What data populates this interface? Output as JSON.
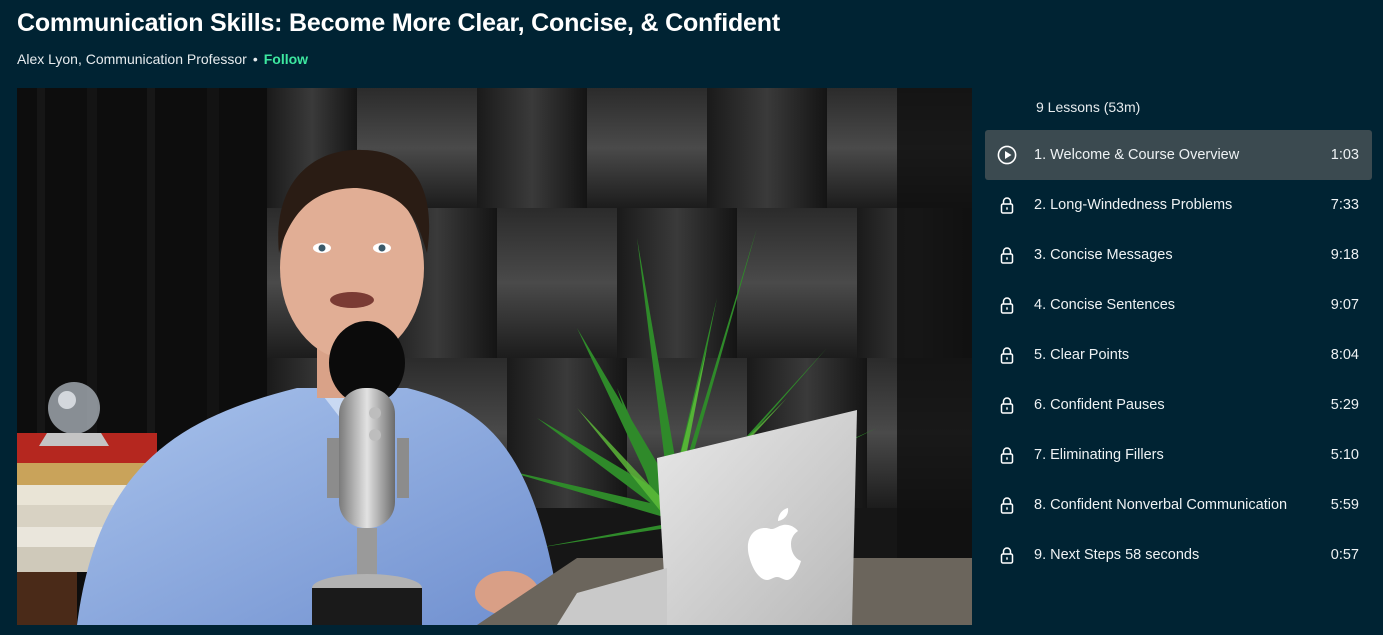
{
  "course": {
    "title": "Communication Skills: Become More Clear, Concise, & Confident",
    "author": "Alex Lyon, Communication Professor",
    "separator": "•",
    "follow_label": "Follow"
  },
  "video": {
    "scene_icon": "apple-logo-icon"
  },
  "lessons_summary": "9 Lessons (53m)",
  "lessons": [
    {
      "label": "1. Welcome & Course Overview",
      "duration": "1:03",
      "state": "playing",
      "icon": "play-circle-icon"
    },
    {
      "label": "2. Long-Windedness Problems",
      "duration": "7:33",
      "state": "locked",
      "icon": "lock-icon"
    },
    {
      "label": "3. Concise Messages",
      "duration": "9:18",
      "state": "locked",
      "icon": "lock-icon"
    },
    {
      "label": "4. Concise Sentences",
      "duration": "9:07",
      "state": "locked",
      "icon": "lock-icon"
    },
    {
      "label": "5. Clear Points",
      "duration": "8:04",
      "state": "locked",
      "icon": "lock-icon"
    },
    {
      "label": "6. Confident Pauses",
      "duration": "5:29",
      "state": "locked",
      "icon": "lock-icon"
    },
    {
      "label": "7. Eliminating Fillers",
      "duration": "5:10",
      "state": "locked",
      "icon": "lock-icon"
    },
    {
      "label": "8. Confident Nonverbal Communication",
      "duration": "5:59",
      "state": "locked",
      "icon": "lock-icon"
    },
    {
      "label": "9. Next Steps 58 seconds",
      "duration": "0:57",
      "state": "locked",
      "icon": "lock-icon"
    }
  ],
  "colors": {
    "background": "#002333",
    "accent": "#3de8a0",
    "active_row": "#3b4a50"
  }
}
